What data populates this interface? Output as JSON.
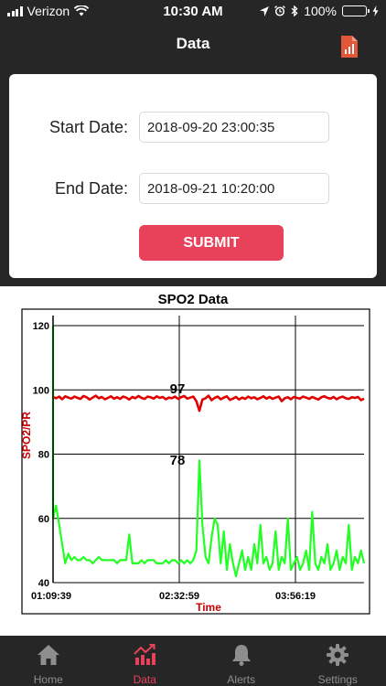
{
  "status_bar": {
    "carrier": "Verizon",
    "time": "10:30 AM",
    "battery": "100%",
    "icons": [
      "signal-icon",
      "wifi-icon",
      "location-icon",
      "alarm-icon",
      "bluetooth-icon",
      "battery-icon",
      "charging-icon"
    ]
  },
  "nav": {
    "title": "Data",
    "report_icon": "report-chart-icon"
  },
  "form": {
    "start_label": "Start Date:",
    "start_value": "2018-09-20 23:00:35",
    "end_label": "End Date:",
    "end_value": "2018-09-21 10:20:00",
    "submit_label": "SUBMIT"
  },
  "chart_data": {
    "type": "line",
    "title": "SPO2 Data",
    "xlabel": "Time",
    "ylabel": "SPO2/PR",
    "ylim": [
      40,
      122
    ],
    "yticks": [
      "40",
      "60",
      "80",
      "100",
      "120"
    ],
    "xticks": [
      "01:09:39",
      "02:32:59",
      "03:56:19"
    ],
    "grid": true,
    "colors": {
      "spo2": "#e00000",
      "pr": "#22ff22",
      "labels": "#cc0000"
    },
    "series": [
      {
        "key": "spo2",
        "values": [
          97.8,
          97.4,
          97.9,
          97.1,
          98.0,
          97.6,
          97.3,
          97.9,
          97.5,
          97.2,
          98.1,
          97.7,
          97.0,
          97.6,
          98.2,
          97.4,
          97.8,
          97.1,
          97.5,
          98.0,
          97.3,
          97.7,
          97.2,
          97.9,
          97.6,
          97.0,
          97.8,
          97.4,
          98.1,
          97.5,
          97.2,
          97.9,
          97.7,
          97.3,
          98.0,
          97.5,
          97.8,
          97.1,
          97.6,
          97.4,
          97.9,
          97.2,
          97.7,
          98.1,
          97.3,
          97.6,
          97.9,
          96.5,
          93.5,
          97.0,
          97.4,
          98.2,
          96.8,
          97.5,
          97.9,
          97.1,
          97.6,
          98.0,
          96.9,
          97.3,
          97.8,
          97.0,
          97.6,
          97.2,
          97.9,
          97.4,
          97.7,
          97.1,
          97.5,
          98.0,
          97.3,
          97.8,
          97.2,
          97.6,
          97.9,
          96.5,
          97.4,
          97.7,
          97.1,
          97.8,
          97.5,
          97.3,
          97.9,
          97.6,
          97.2,
          97.8,
          97.4,
          97.0,
          97.7,
          98.0,
          97.5,
          97.3,
          97.8,
          97.1,
          97.6,
          97.9,
          97.4,
          97.2,
          97.7,
          97.5,
          97.8,
          96.8,
          97.3
        ],
        "peak_label": "97"
      },
      {
        "key": "pr",
        "values": [
          60,
          64,
          58,
          52,
          46,
          49,
          47,
          48,
          47,
          47,
          48,
          47,
          47,
          46,
          47,
          48,
          47,
          47,
          47,
          47,
          47,
          46,
          47,
          47,
          47,
          55,
          46,
          46,
          46,
          47,
          46,
          47,
          47,
          47,
          46,
          46,
          46,
          47,
          46,
          47,
          47,
          46,
          47,
          46,
          47,
          46,
          47,
          50,
          78,
          58,
          48,
          46,
          54,
          60,
          58,
          46,
          56,
          44,
          52,
          46,
          42,
          46,
          50,
          44,
          48,
          44,
          52,
          46,
          58,
          46,
          48,
          44,
          46,
          56,
          44,
          48,
          46,
          60,
          44,
          46,
          48,
          44,
          46,
          50,
          44,
          62,
          46,
          44,
          48,
          46,
          52,
          44,
          46,
          50,
          44,
          48,
          46,
          58,
          44,
          48,
          46,
          50,
          46
        ],
        "peak_label": "78"
      }
    ]
  },
  "tabs": [
    {
      "label": "Home",
      "icon": "home-icon",
      "active": false
    },
    {
      "label": "Data",
      "icon": "chart-trend-icon",
      "active": true
    },
    {
      "label": "Alerts",
      "icon": "bell-icon",
      "active": false
    },
    {
      "label": "Settings",
      "icon": "gear-icon",
      "active": false
    }
  ]
}
